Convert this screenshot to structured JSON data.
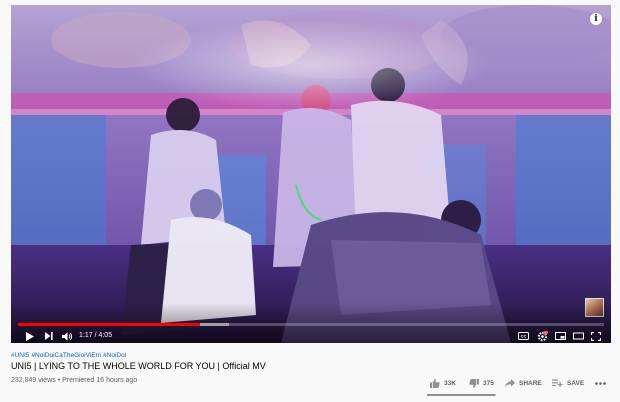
{
  "player": {
    "time_current": "1:17",
    "time_separator": " / ",
    "time_total": "4:05",
    "played_fraction": 0.31,
    "loaded_fraction": 0.36,
    "info_glyph": "i",
    "icons": [
      "play-icon",
      "next-icon",
      "volume-icon",
      "captions-icon",
      "settings-icon",
      "miniplayer-icon",
      "theater-icon",
      "fullscreen-icon",
      "info-icon"
    ]
  },
  "video": {
    "hashtags": [
      "#UNI5",
      "#NoiDoiCaTheGioiViEm",
      "#NoiDoi"
    ],
    "title": "UNI5 | LYING TO THE WHOLE WORLD FOR YOU | Official MV",
    "views": "232,849 views",
    "separator": " • ",
    "premiered": "Premiered 16 hours ago"
  },
  "actions": {
    "like_count": "33K",
    "dislike_count": "375",
    "share_label": "SHARE",
    "save_label": "SAVE",
    "like_ratio": 0.99
  },
  "colors": {
    "progress_played": "#ff0000",
    "hashtag_link": "#065fd4",
    "title_text": "#030303",
    "meta_text": "#606060",
    "scene_purple": "#8a4fc8",
    "scene_pink": "#d04aa8",
    "scene_blue": "#3a8ee0"
  }
}
